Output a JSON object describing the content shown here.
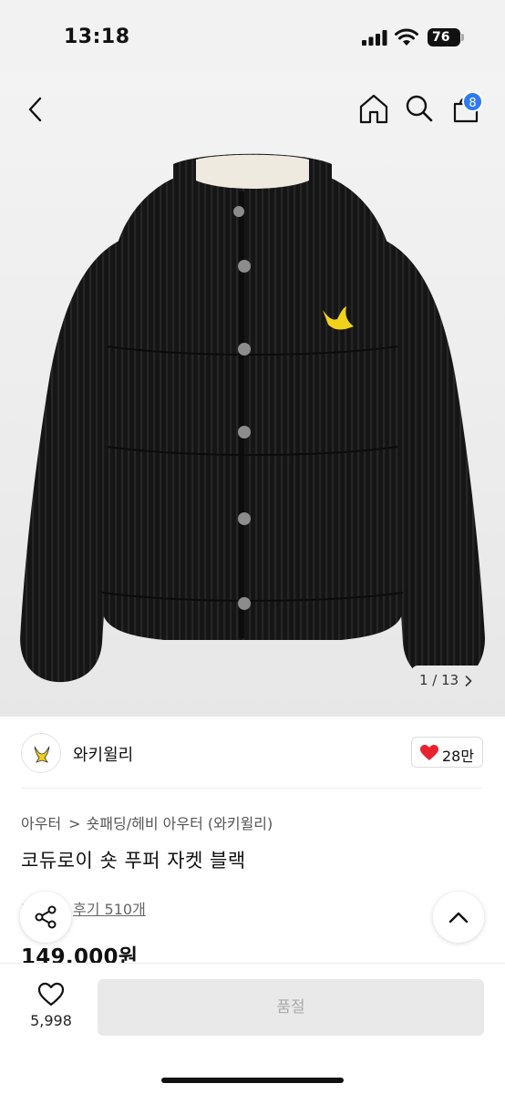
{
  "status_bar": {
    "time": "13:18",
    "battery": "76"
  },
  "header": {
    "cart_count": "8"
  },
  "gallery": {
    "counter": "1 / 13"
  },
  "brand": {
    "name": "와키윌리",
    "like_count": "28만"
  },
  "product": {
    "breadcrumb": [
      "아우터",
      "숏패딩/헤비 아우터 (와키윌리)"
    ],
    "title": "코듀로이 숏 푸퍼 자켓 블랙",
    "review_link": "후기 510개",
    "price": "149,000원"
  },
  "bottom_bar": {
    "wishlist_count": "5,998",
    "buy_label": "품절"
  },
  "colors": {
    "accent_blue": "#2f7bf5",
    "heart_red": "#e8232f",
    "jacket": "#141414"
  }
}
